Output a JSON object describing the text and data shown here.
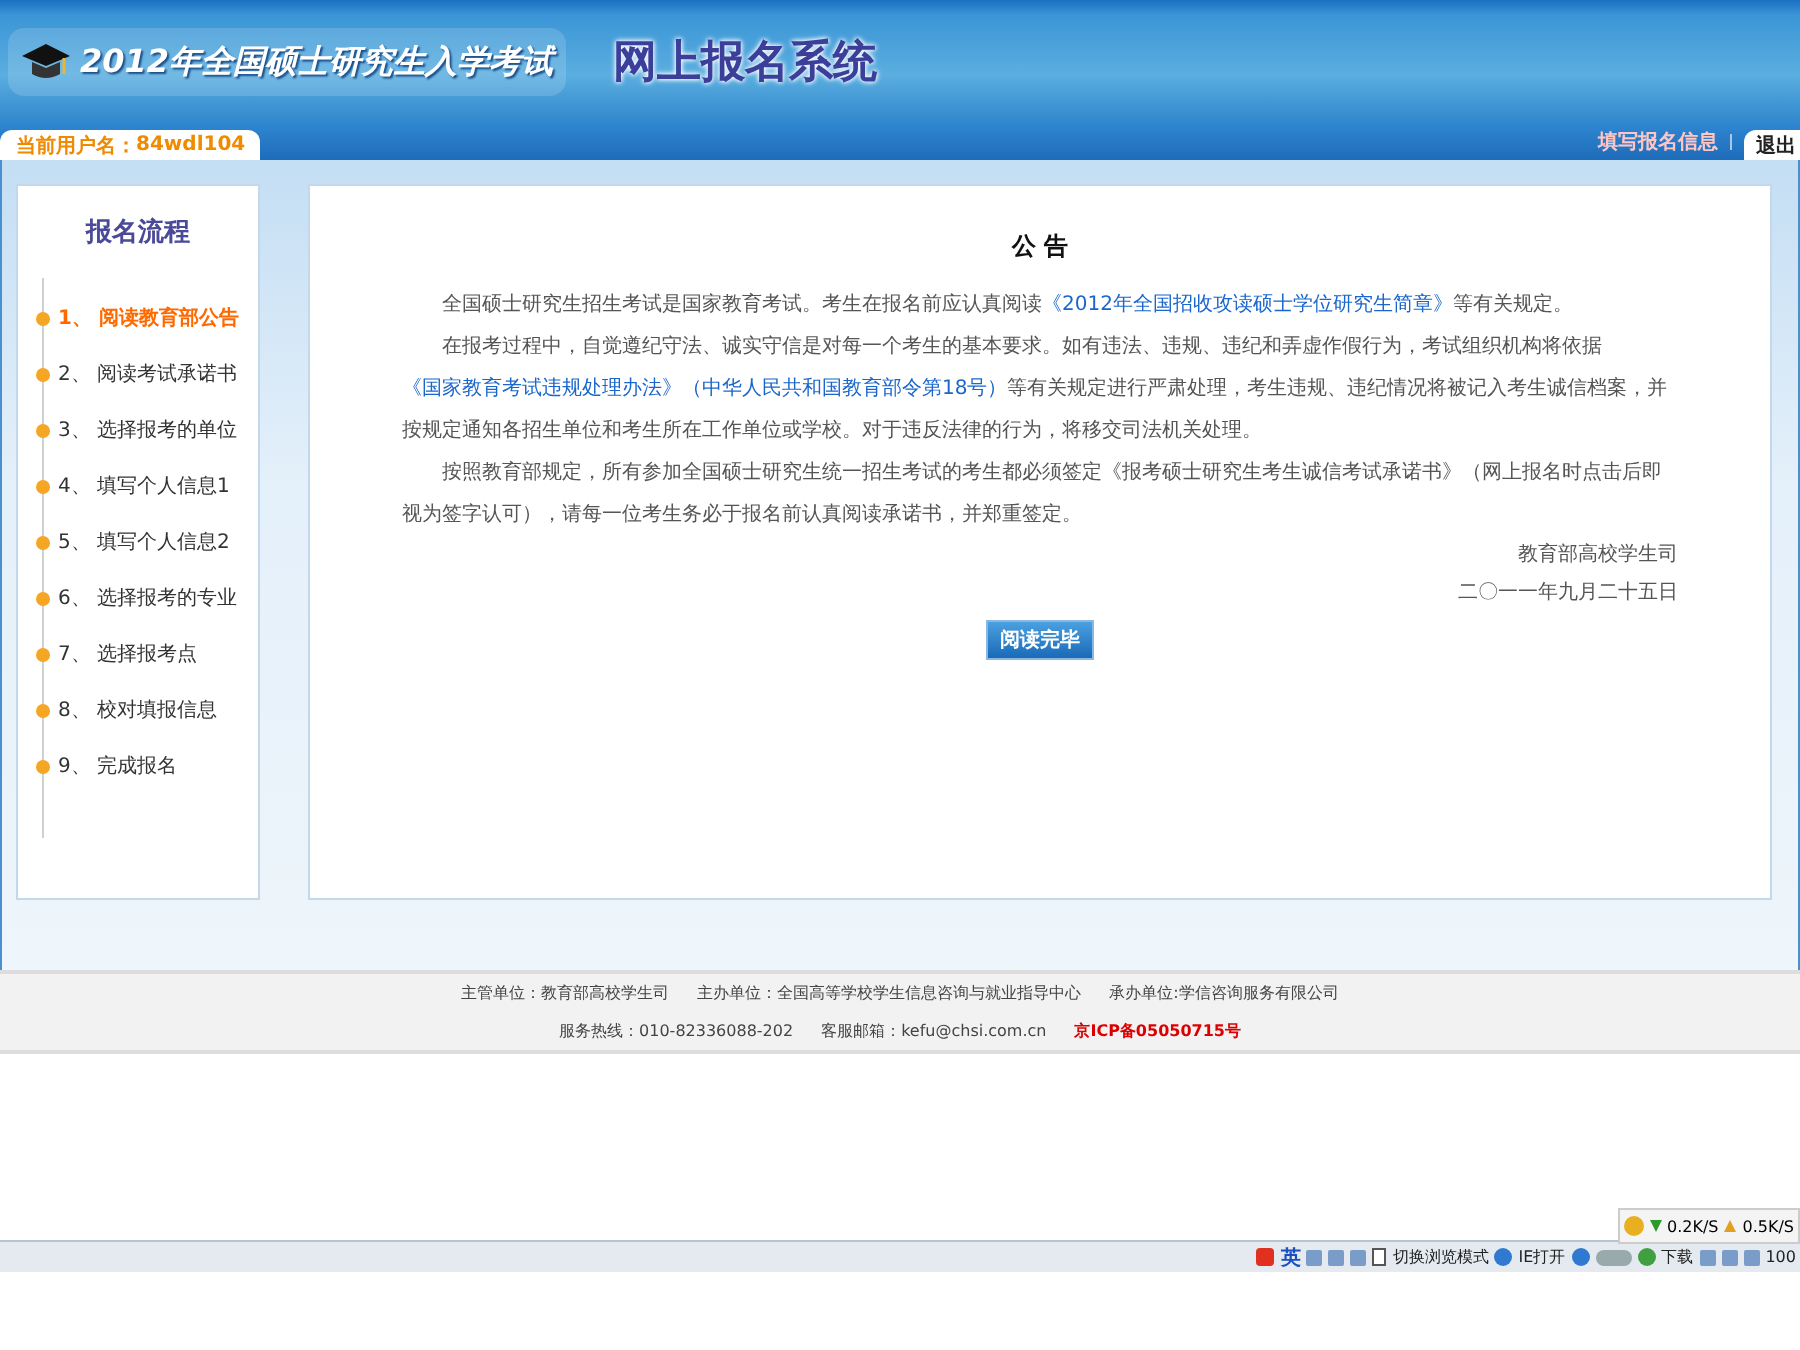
{
  "header": {
    "exam_title": "2012年全国硕士研究生入学考试",
    "system_title": "网上报名系统"
  },
  "user_bar": {
    "user_label": "当前用户名：",
    "username": "84wdl104",
    "right_link": "填写报名信息",
    "logout": "退出"
  },
  "sidebar": {
    "title": "报名流程",
    "steps": [
      {
        "number": "1、",
        "label": "阅读教育部公告",
        "selected": true
      },
      {
        "number": "2、",
        "label": "阅读考试承诺书",
        "selected": false
      },
      {
        "number": "3、",
        "label": "选择报考的单位",
        "selected": false
      },
      {
        "number": "4、",
        "label": "填写个人信息1",
        "selected": false
      },
      {
        "number": "5、",
        "label": "填写个人信息2",
        "selected": false
      },
      {
        "number": "6、",
        "label": "选择报考的专业",
        "selected": false
      },
      {
        "number": "7、",
        "label": "选择报考点",
        "selected": false
      },
      {
        "number": "8、",
        "label": "校对填报信息",
        "selected": false
      },
      {
        "number": "9、",
        "label": "完成报名",
        "selected": false
      }
    ]
  },
  "notice": {
    "title": "公 告",
    "paragraphs": [
      [
        {
          "kind": "text",
          "text": "全国硕士研究生招生考试是国家教育考试。考生在报名前应认真阅读"
        },
        {
          "kind": "link",
          "text": "《2012年全国招收攻读硕士学位研究生简章》"
        },
        {
          "kind": "text",
          "text": "等有关规定。"
        }
      ],
      [
        {
          "kind": "text",
          "text": "在报考过程中，自觉遵纪守法、诚实守信是对每一个考生的基本要求。如有违法、违规、违纪和弄虚作假行为，考试组织机构将依据"
        },
        {
          "kind": "link",
          "text": "《国家教育考试违规处理办法》"
        },
        {
          "kind": "link",
          "text": "（中华人民共和国教育部令第18号）"
        },
        {
          "kind": "text",
          "text": "等有关规定进行严肃处理，考生违规、违纪情况将被记入考生诚信档案，并按规定通知各招生单位和考生所在工作单位或学校。对于违反法律的行为，将移交司法机关处理。"
        }
      ],
      [
        {
          "kind": "text",
          "text": "按照教育部规定，所有参加全国硕士研究生统一招生考试的考生都必须签定《报考硕士研究生考生诚信考试承诺书》（网上报名时点击后即视为签字认可），请每一位考生务必于报名前认真阅读承诺书，并郑重签定。"
        }
      ]
    ],
    "signature": "教育部高校学生司",
    "date": "二〇一一年九月二十五日",
    "button": "阅读完毕"
  },
  "footer": [
    [
      {
        "kind": "text",
        "text": "主管单位：教育部高校学生司"
      },
      {
        "kind": "text",
        "text": "主办单位：全国高等学校学生信息咨询与就业指导中心"
      },
      {
        "kind": "text",
        "text": "承办单位:学信咨询服务有限公司"
      }
    ],
    [
      {
        "kind": "text",
        "text": "服务热线：010-82336088-202"
      },
      {
        "kind": "text",
        "text": "客服邮箱：kefu@chsi.com.cn"
      },
      {
        "kind": "license",
        "text": "京ICP备05050715号"
      }
    ]
  ],
  "speed_widget": {
    "down": "0.2K/S",
    "up": "0.5K/S"
  },
  "status_bar": {
    "ime": "英",
    "switch_mode": "切换浏览模式",
    "ie_open": "IE打开",
    "download": "下载",
    "zoom": "100"
  }
}
